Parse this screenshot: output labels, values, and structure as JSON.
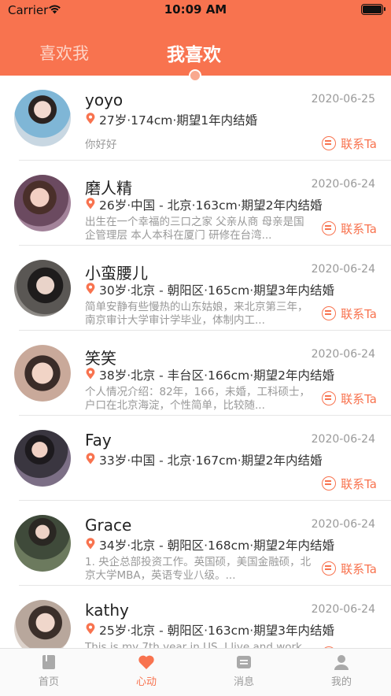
{
  "status_bar": {
    "carrier": "Carrier",
    "time": "10:09 AM"
  },
  "top_tabs": [
    {
      "label": "喜欢我",
      "active": false
    },
    {
      "label": "我喜欢",
      "active": true
    }
  ],
  "colors": {
    "accent": "#F8734F",
    "muted_tab": "#FDD3C6",
    "text_gray": "#999999"
  },
  "contact_label": "联系Ta",
  "items": [
    {
      "name": "yoyo",
      "date": "2020-06-25",
      "info": "27岁·174cm·期望1年内结婚",
      "desc": "你好好",
      "avatar_color": "#7fb6d6"
    },
    {
      "name": "磨人精",
      "date": "2020-06-24",
      "info": "26岁·中国 - 北京·163cm·期望2年内结婚",
      "desc": "出生在一个幸福的三口之家 父亲从商 母亲是国企管理层 本人本科在厦门 研修在台湾...",
      "avatar_color": "#6b4a60"
    },
    {
      "name": "小蛮腰儿",
      "date": "2020-06-24",
      "info": "30岁·北京 - 朝阳区·165cm·期望3年内结婚",
      "desc": "简单安静有些慢热的山东姑娘，来北京第三年，南京审计大学审计学毕业，体制内工...",
      "avatar_color": "#5a5754"
    },
    {
      "name": "笑笑",
      "date": "2020-06-24",
      "info": "38岁·北京 - 丰台区·166cm·期望2年内结婚",
      "desc": "个人情况介绍：82年，166，未婚，工科硕士，户口在北京海淀，个性简单，比较随...",
      "avatar_color": "#c9a99a"
    },
    {
      "name": "Fay",
      "date": "2020-06-24",
      "info": "33岁·中国 - 北京·167cm·期望2年内结婚",
      "desc": "",
      "avatar_color": "#3a3640"
    },
    {
      "name": "Grace",
      "date": "2020-06-24",
      "info": "34岁·北京 - 朝阳区·168cm·期望2年内结婚",
      "desc": "1. 央企总部投资工作。英国硕，美国金融硕，北京大学MBA，英语专业八级。...",
      "avatar_color": "#3f4a3a"
    },
    {
      "name": "kathy",
      "date": "2020-06-24",
      "info": "25岁·北京 - 朝阳区·163cm·期望3年内结婚",
      "desc": "This is my 7th year in US. I live and work",
      "avatar_color": "#b8a79c"
    }
  ],
  "bottom_tabs": [
    {
      "label": "首页",
      "icon": "book-icon",
      "active": false
    },
    {
      "label": "心动",
      "icon": "heart-icon",
      "active": true
    },
    {
      "label": "消息",
      "icon": "message-icon",
      "active": false
    },
    {
      "label": "我的",
      "icon": "person-icon",
      "active": false
    }
  ]
}
